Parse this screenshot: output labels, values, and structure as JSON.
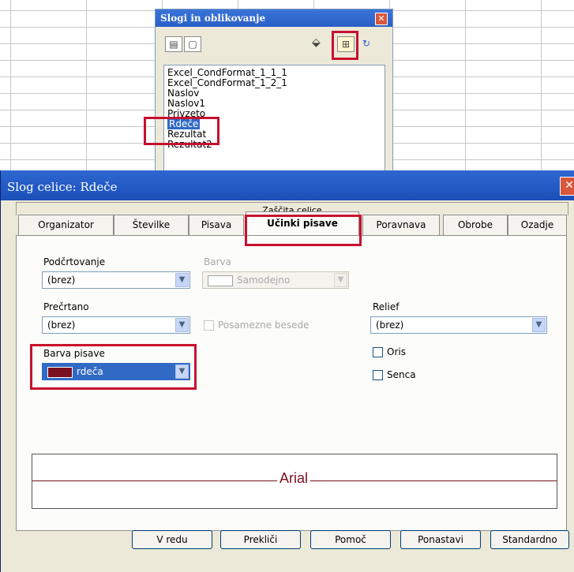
{
  "stylist": {
    "title": "Slogi in oblikovanje",
    "close_icon": "close-icon",
    "styles": [
      "Excel_CondFormat_1_1_1",
      "Excel_CondFormat_1_2_1",
      "Naslov",
      "Naslov1",
      "Privzeto",
      "Rdeče",
      "Rezultat",
      "Rezultat2"
    ],
    "selected": "Rdeče"
  },
  "dialog": {
    "title": "Slog celice: Rdeče",
    "tab_top_label": "Zaščita celice",
    "tabs": [
      "Organizator",
      "Številke",
      "Pisava",
      "Učinki pisave",
      "Poravnava",
      "Obrobe",
      "Ozadje"
    ],
    "active_tab": "Učinki pisave",
    "underline": {
      "label": "Podčrtovanje",
      "value": "(brez)"
    },
    "color": {
      "label": "Barva",
      "value": "Samodejno"
    },
    "strikethrough": {
      "label": "Prečrtano",
      "value": "(brez)"
    },
    "individual_words": {
      "label": "Posamezne besede",
      "checked": false
    },
    "relief": {
      "label": "Relief",
      "value": "(brez)"
    },
    "outline": {
      "label": "Oris",
      "checked": false
    },
    "shadow": {
      "label": "Senca",
      "checked": false
    },
    "font_color": {
      "label": "Barva pisave",
      "value": "rdeča",
      "swatch": "#7a1020"
    },
    "preview_text": "Arial",
    "buttons": {
      "ok": "V redu",
      "cancel": "Prekliči",
      "help": "Pomoč",
      "reset": "Ponastavi",
      "standard": "Standardno"
    }
  },
  "colors": {
    "highlight": "#c8102e",
    "title_bar": "#2a5fc6",
    "preview_text": "#7a1020"
  }
}
